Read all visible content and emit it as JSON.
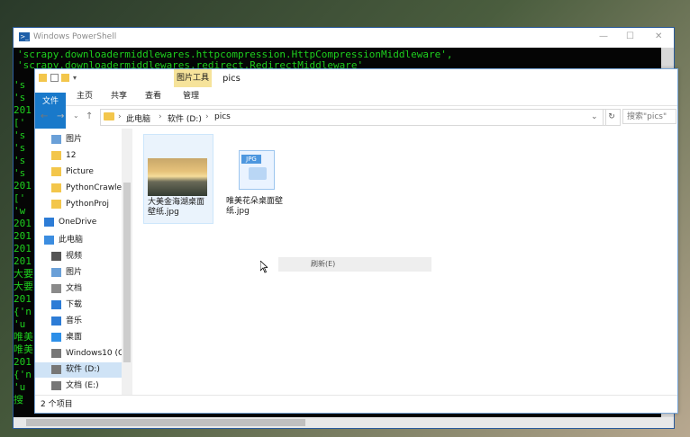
{
  "powershell": {
    "title": "Windows PowerShell",
    "lines": [
      "'scrapy.downloadermiddlewares.httpcompression.HttpCompressionMiddleware',",
      "'scrapy.downloadermiddlewares.redirect.RedirectMiddleware'"
    ],
    "left_chars": [
      "'s",
      "'s",
      "201",
      "['",
      "'s",
      "'s",
      "'s",
      "'s",
      "201",
      "['",
      "'w",
      "201",
      "201",
      "201",
      "201",
      "大要",
      "大要",
      "201",
      "{'n",
      "'u",
      "唯美",
      "唯美",
      "201",
      "{'n",
      "'u",
      "搜"
    ]
  },
  "explorer": {
    "window_title": "pics",
    "context_tab": "图片工具",
    "ribbon_tabs": [
      "文件",
      "主页",
      "共享",
      "查看",
      "管理"
    ],
    "breadcrumbs": [
      "此电脑",
      "软件 (D:)",
      "pics"
    ],
    "search_placeholder": "搜索\"pics\"",
    "nav": [
      {
        "label": "图片",
        "icon": "pictures-icon"
      },
      {
        "label": "12",
        "icon": "folder-icon"
      },
      {
        "label": "Picture",
        "icon": "folder-icon"
      },
      {
        "label": "PythonCrawler-",
        "icon": "folder-icon"
      },
      {
        "label": "PythonProj",
        "icon": "folder-icon"
      },
      {
        "label": "OneDrive",
        "icon": "cloud-icon"
      },
      {
        "label": "此电脑",
        "icon": "computer-icon"
      },
      {
        "label": "视频",
        "icon": "video-icon"
      },
      {
        "label": "图片",
        "icon": "pictures-icon"
      },
      {
        "label": "文档",
        "icon": "document-icon"
      },
      {
        "label": "下载",
        "icon": "download-icon"
      },
      {
        "label": "音乐",
        "icon": "music-icon"
      },
      {
        "label": "桌面",
        "icon": "desktop-icon"
      },
      {
        "label": "Windows10 (C:",
        "icon": "drive-icon"
      },
      {
        "label": "软件 (D:)",
        "icon": "drive-icon"
      },
      {
        "label": "文档 (E:)",
        "icon": "drive-icon"
      }
    ],
    "files": [
      {
        "name": "大美金海湖桌面壁纸.jpg"
      },
      {
        "name": "唯美花朵桌面壁纸.jpg"
      }
    ],
    "context_menu_item": "刷新(E)",
    "status": "2 个项目",
    "jpg_label": "JPG"
  }
}
